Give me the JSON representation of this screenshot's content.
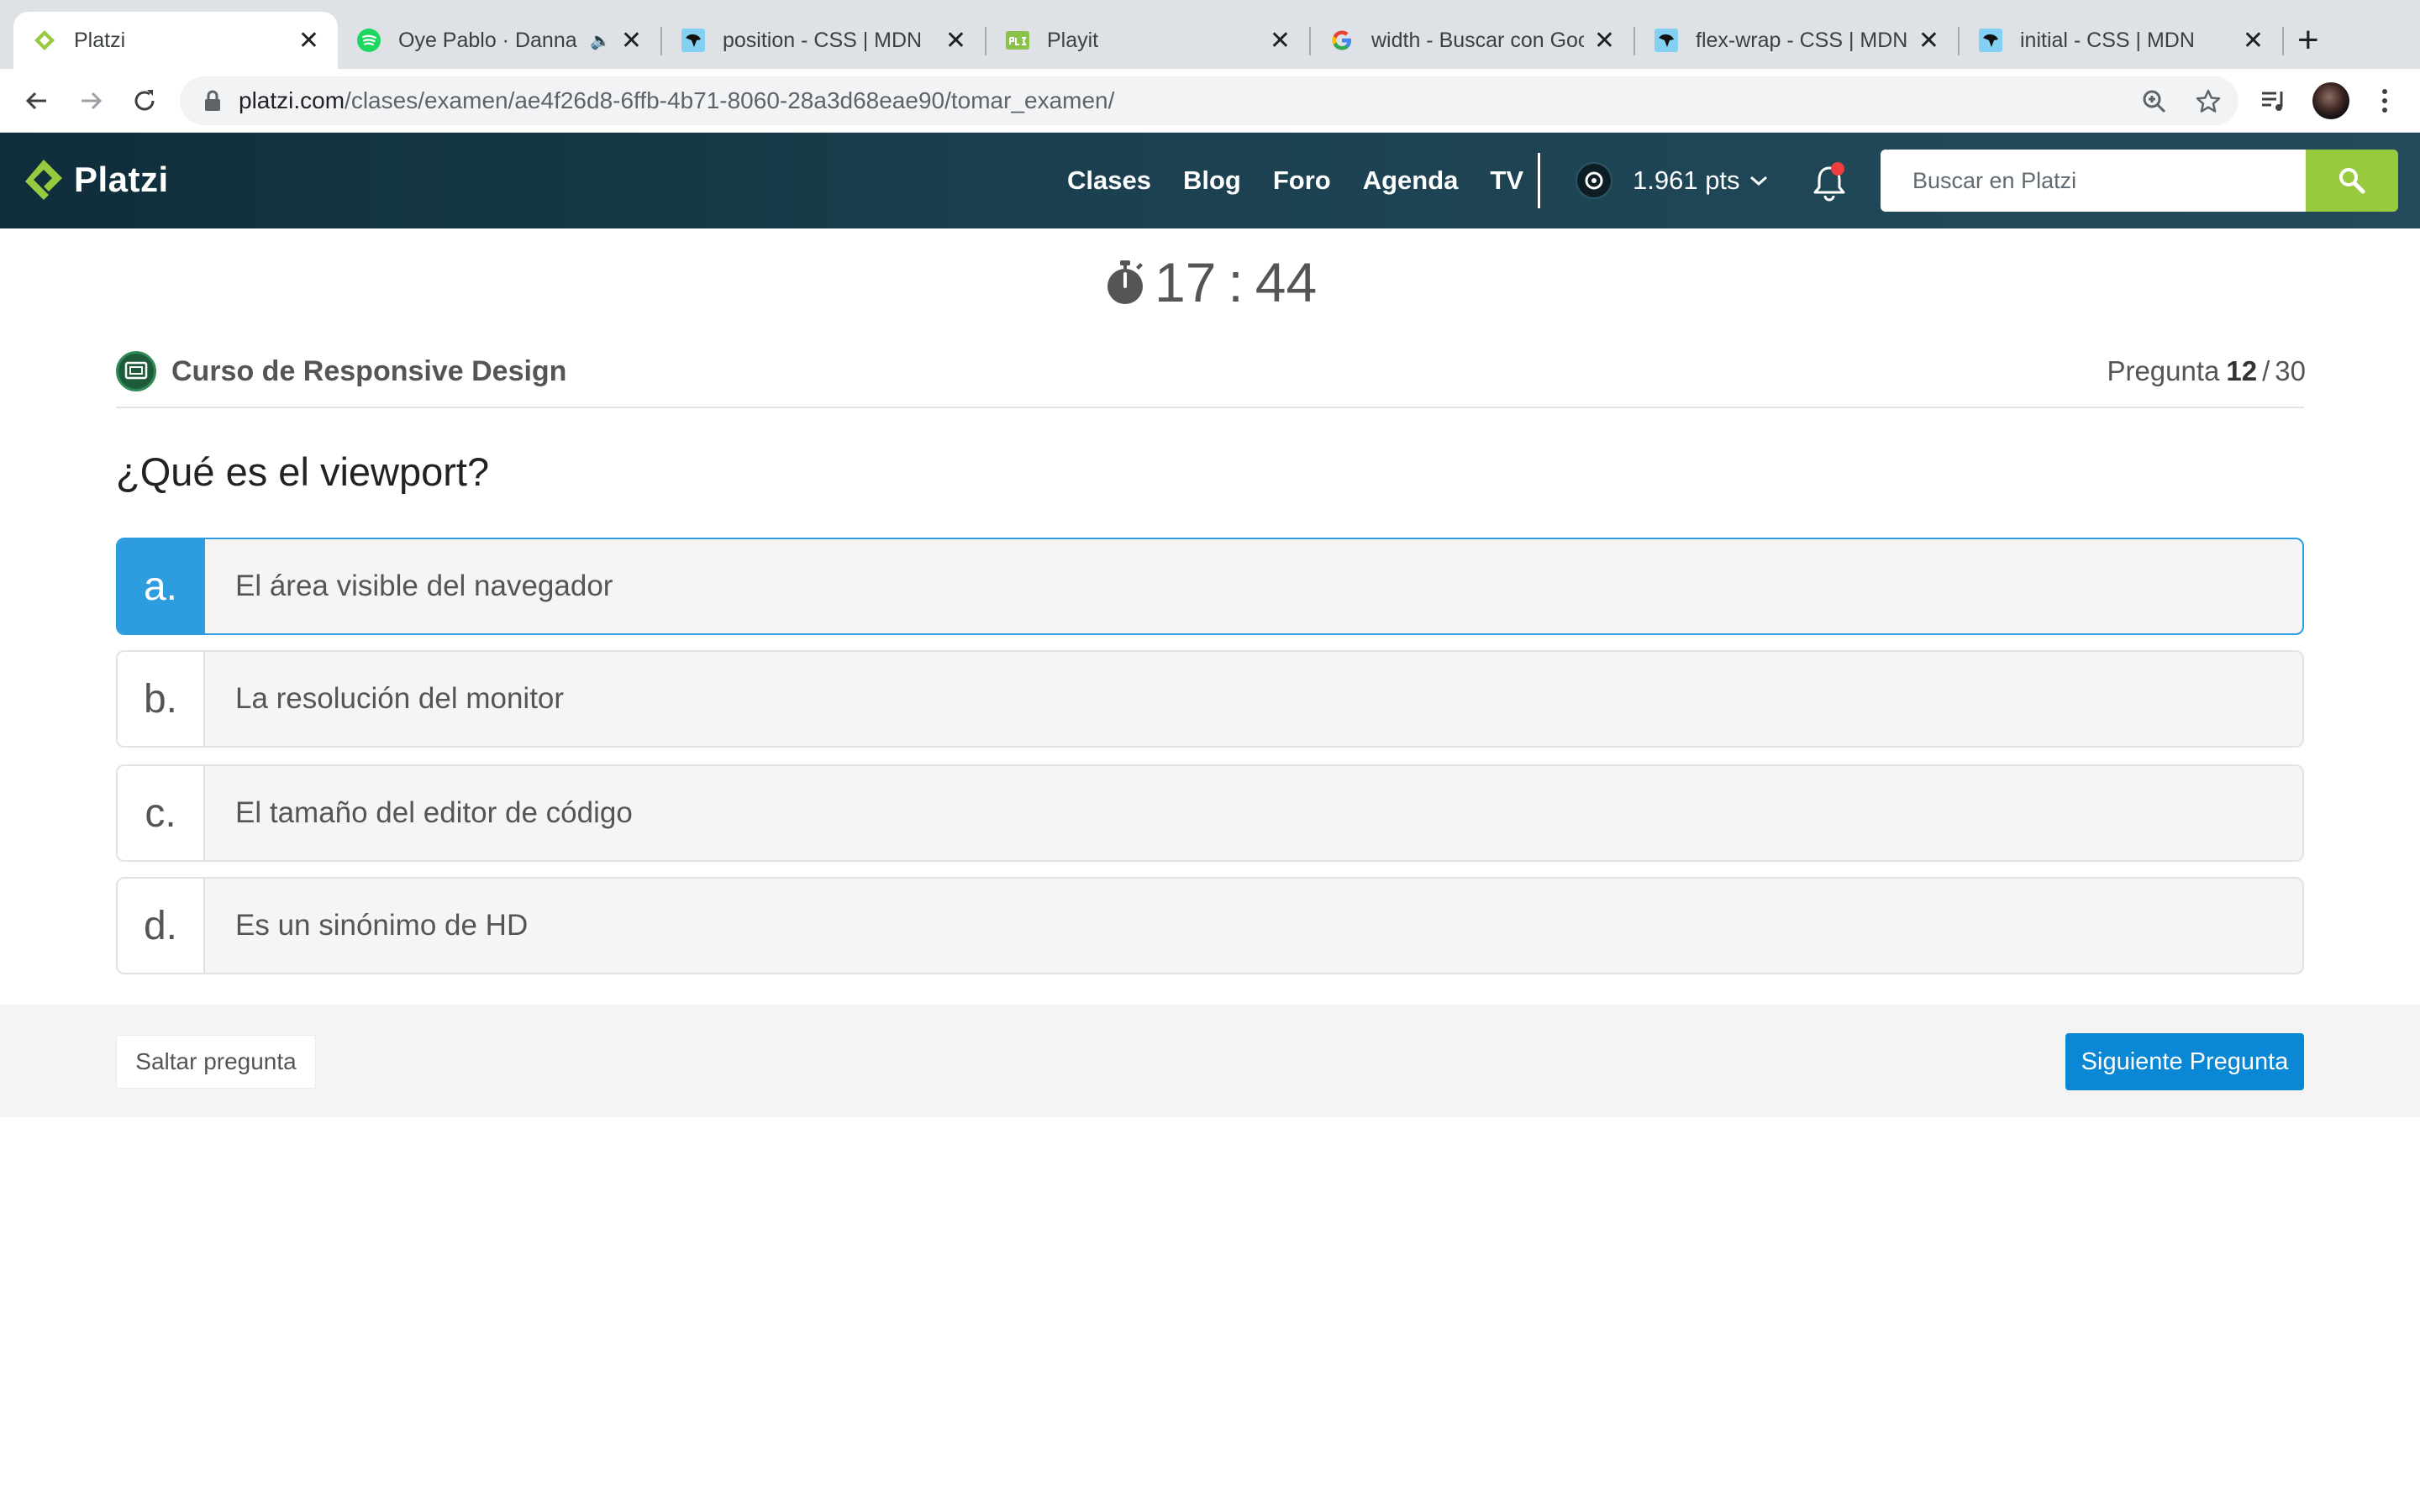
{
  "browser": {
    "tabs": [
      {
        "title": "Platzi",
        "favicon": "platzi-icon",
        "active": true
      },
      {
        "title": "Oye Pablo · Danna Paola",
        "favicon": "spotify-icon",
        "audio": true
      },
      {
        "title": "position - CSS | MDN",
        "favicon": "mdn-icon"
      },
      {
        "title": "Playit",
        "favicon": "playit-icon"
      },
      {
        "title": "width - Buscar con Google",
        "favicon": "google-icon"
      },
      {
        "title": "flex-wrap - CSS | MDN",
        "favicon": "mdn-icon"
      },
      {
        "title": "initial - CSS | MDN",
        "favicon": "mdn-icon"
      }
    ],
    "url_host": "platzi.com",
    "url_path": "/clases/examen/ae4f26d8-6ffb-4b71-8060-28a3d68eae90/tomar_examen/"
  },
  "header": {
    "logo_text": "Platzi",
    "nav": [
      "Clases",
      "Blog",
      "Foro",
      "Agenda",
      "TV"
    ],
    "points": "1.961 pts",
    "search_placeholder": "Buscar en Platzi"
  },
  "exam": {
    "timer_min": "17",
    "timer_sep": ":",
    "timer_sec": "44",
    "course": "Curso de Responsive Design",
    "question_label": "Pregunta",
    "question_current": "12",
    "question_sep": "/",
    "question_total": "30",
    "question": "¿Qué es el viewport?",
    "options": [
      {
        "letter": "a.",
        "text": "El área visible del navegador",
        "selected": true
      },
      {
        "letter": "b.",
        "text": "La resolución del monitor",
        "selected": false
      },
      {
        "letter": "c.",
        "text": "El tamaño del editor de código",
        "selected": false
      },
      {
        "letter": "d.",
        "text": "Es un sinónimo de HD",
        "selected": false
      }
    ],
    "skip_label": "Saltar pregunta",
    "next_label": "Siguiente Pregunta"
  },
  "colors": {
    "header_bg": "#1c4252",
    "accent_green": "#98ca3f",
    "selected_blue": "#2d9de0",
    "next_button": "#0a88d6"
  }
}
